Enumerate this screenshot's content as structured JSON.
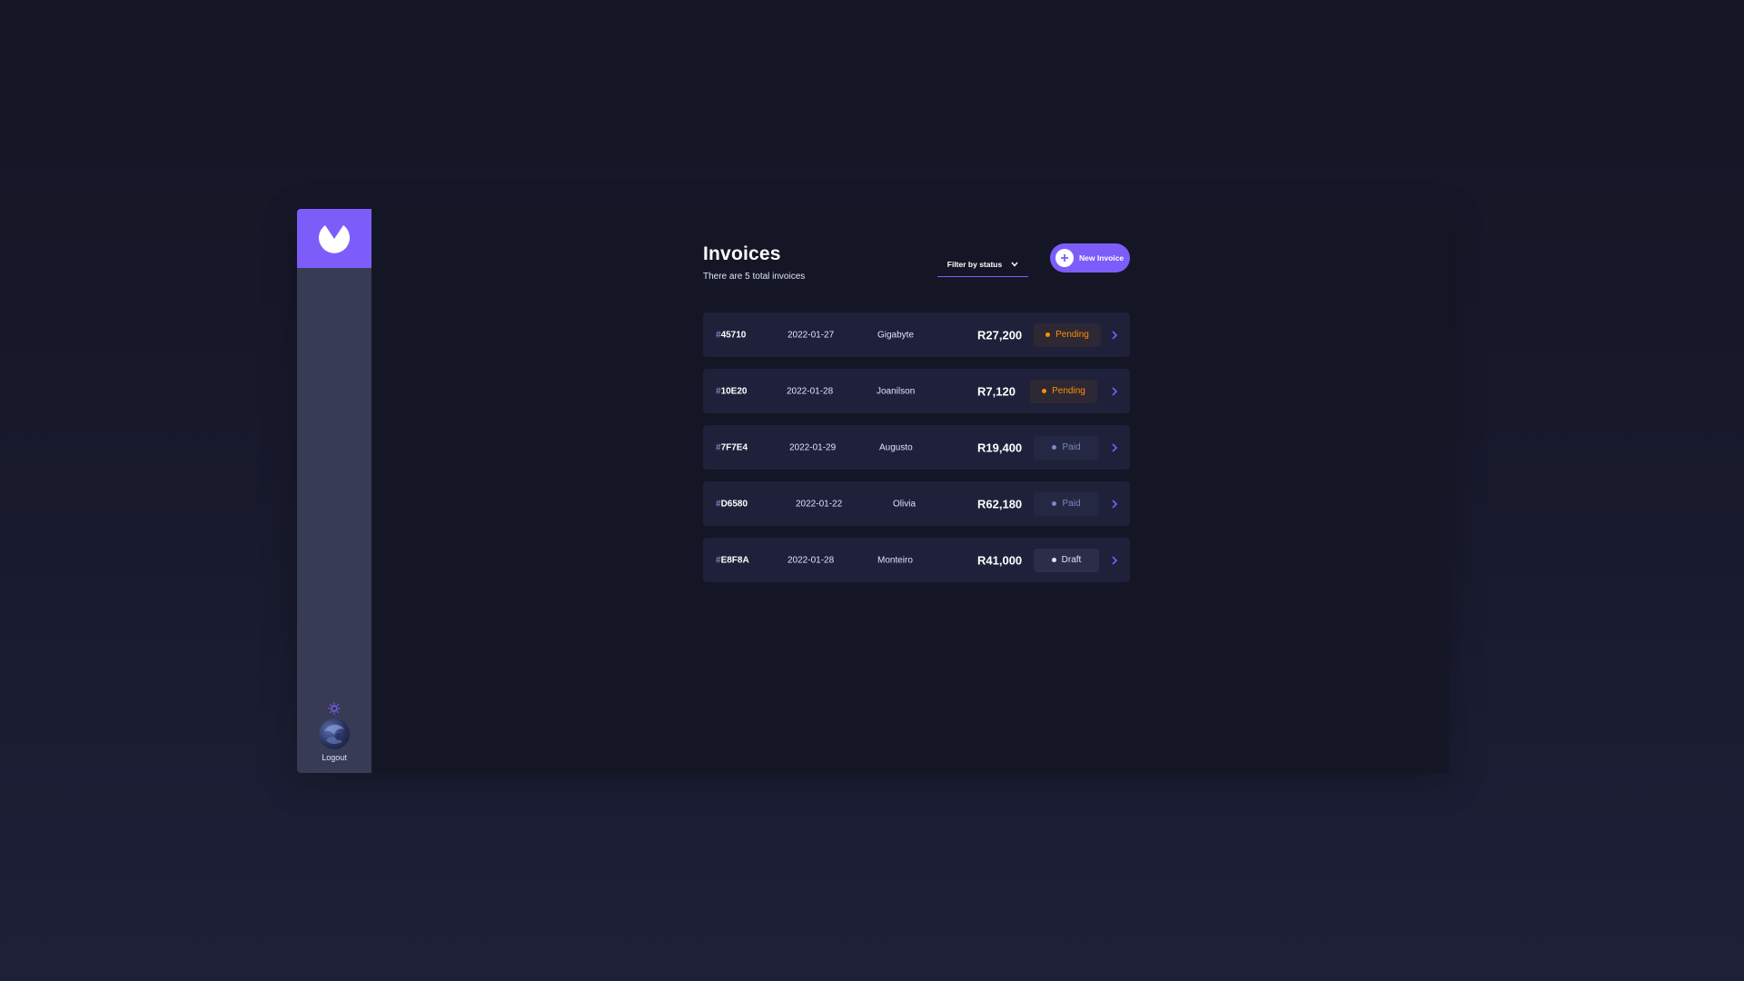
{
  "sidebar": {
    "logo_icon": "logo-icon",
    "theme_icon": "theme-toggle-icon",
    "avatar_icon": "avatar",
    "logout_label": "Logout"
  },
  "header": {
    "title": "Invoices",
    "subtitle": "There are 5 total invoices",
    "filter_label": "Filter by status",
    "new_invoice_label": "New Invoice"
  },
  "invoices": [
    {
      "hash": "#",
      "id": "45710",
      "date": "2022-01-27",
      "client": "Gigabyte",
      "amount": "R27,200",
      "status": "Pending"
    },
    {
      "hash": "#",
      "id": "10E20",
      "date": "2022-01-28",
      "client": "Joanilson",
      "amount": "R7,120",
      "status": "Pending"
    },
    {
      "hash": "#",
      "id": "7F7E4",
      "date": "2022-01-29",
      "client": "Augusto",
      "amount": "R19,400",
      "status": "Paid"
    },
    {
      "hash": "#",
      "id": "D6580",
      "date": "2022-01-22",
      "client": "Olivia",
      "amount": "R62,180",
      "status": "Paid"
    },
    {
      "hash": "#",
      "id": "E8F8A",
      "date": "2022-01-28",
      "client": "Monteiro",
      "amount": "R41,000",
      "status": "Draft"
    }
  ],
  "colors": {
    "accent": "#7c5dfa",
    "pending": "#ff8f00",
    "paid": "#7e88c3",
    "draft": "#dfe3fa",
    "card": "#1e2139",
    "sidebar": "#373b53"
  }
}
